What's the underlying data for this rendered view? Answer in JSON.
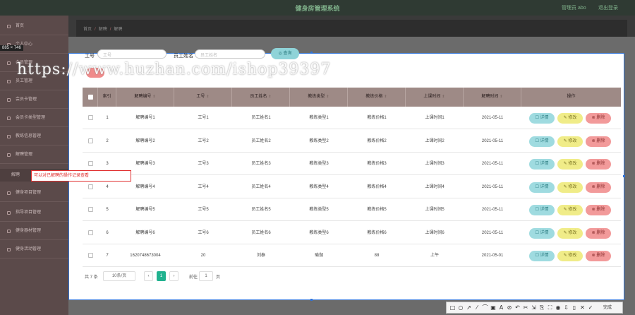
{
  "app": {
    "title": "健身房管理系统",
    "admin_label": "管理员 abo",
    "logout_label": "退出登录"
  },
  "size_tag": "885 × 746",
  "sidebar": {
    "items": [
      {
        "label": "首页"
      },
      {
        "label": "个人中心"
      },
      {
        "label": "会员管理"
      },
      {
        "label": "员工管理"
      },
      {
        "label": "会员卡管理"
      },
      {
        "label": "会员卡类型管理"
      },
      {
        "label": "教练信息管理"
      },
      {
        "label": "解聘管理"
      },
      {
        "label": "解聘"
      },
      {
        "label": "健身项目管理"
      },
      {
        "label": "指导项目管理"
      },
      {
        "label": "健身器材管理"
      },
      {
        "label": "健身活动管理"
      }
    ]
  },
  "breadcrumb": {
    "home": "首页",
    "mid": "解聘",
    "current": "解聘"
  },
  "search": {
    "label_no": "工号",
    "placeholder_no": "工号",
    "label_name": "员工姓名",
    "placeholder_name": "员工姓名",
    "query_label": "◎ 查询"
  },
  "watermark": "https://www.huzhan.com/ishop39397",
  "table": {
    "headers": [
      "索引",
      "解聘编号",
      "工号",
      "员工姓名",
      "教练类型",
      "教练价格",
      "上课时间",
      "解聘时间",
      "操作"
    ],
    "sort_glyph": "⇕",
    "rows": [
      {
        "idx": "1",
        "code": "解聘编号1",
        "no": "工号1",
        "name": "员工姓名1",
        "type": "教练类型1",
        "price": "教练价格1",
        "time": "上课时间1",
        "date": "2021-05-11"
      },
      {
        "idx": "2",
        "code": "解聘编号2",
        "no": "工号2",
        "name": "员工姓名2",
        "type": "教练类型2",
        "price": "教练价格2",
        "time": "上课时间2",
        "date": "2021-05-11"
      },
      {
        "idx": "3",
        "code": "解聘编号3",
        "no": "工号3",
        "name": "员工姓名3",
        "type": "教练类型3",
        "price": "教练价格3",
        "time": "上课时间3",
        "date": "2021-05-11"
      },
      {
        "idx": "4",
        "code": "解聘编号4",
        "no": "工号4",
        "name": "员工姓名4",
        "type": "教练类型4",
        "price": "教练价格4",
        "time": "上课时间4",
        "date": "2021-05-11"
      },
      {
        "idx": "5",
        "code": "解聘编号5",
        "no": "工号5",
        "name": "员工姓名5",
        "type": "教练类型5",
        "price": "教练价格5",
        "time": "上课时间5",
        "date": "2021-05-11"
      },
      {
        "idx": "6",
        "code": "解聘编号6",
        "no": "工号6",
        "name": "员工姓名6",
        "type": "教练类型6",
        "price": "教练价格6",
        "time": "上课时间6",
        "date": "2021-05-11"
      },
      {
        "idx": "7",
        "code": "1620748673004",
        "no": "20",
        "name": "刘泰",
        "type": "瑜伽",
        "price": "88",
        "time": "上午",
        "date": "2021-05-01"
      }
    ],
    "ops": {
      "detail": "☐ 详情",
      "edit": "✎ 修改",
      "del": "⊗ 删除"
    }
  },
  "pager": {
    "total": "共 7 条",
    "page_size": "10条/页",
    "prev": "‹",
    "current": "1",
    "next": "›",
    "goto_label": "前往",
    "goto_value": "1",
    "page_suffix": "页"
  },
  "annotation": "可以对已解聘的操作记录查看",
  "toolbar": {
    "icons": [
      "□",
      "○",
      "↗",
      "⁄",
      "⌒",
      "▣",
      "A",
      "⊘",
      "↶",
      "✂",
      "⇲",
      "⎘",
      "⛶",
      "◉",
      "⇩",
      "▯",
      "✕",
      "✓"
    ],
    "done_label": "完成"
  },
  "colors": {
    "accent": "#21b28f",
    "header_bg": "#9e8a86",
    "sidebar_bg": "#5b4a4a",
    "annotation": "#e03030"
  }
}
